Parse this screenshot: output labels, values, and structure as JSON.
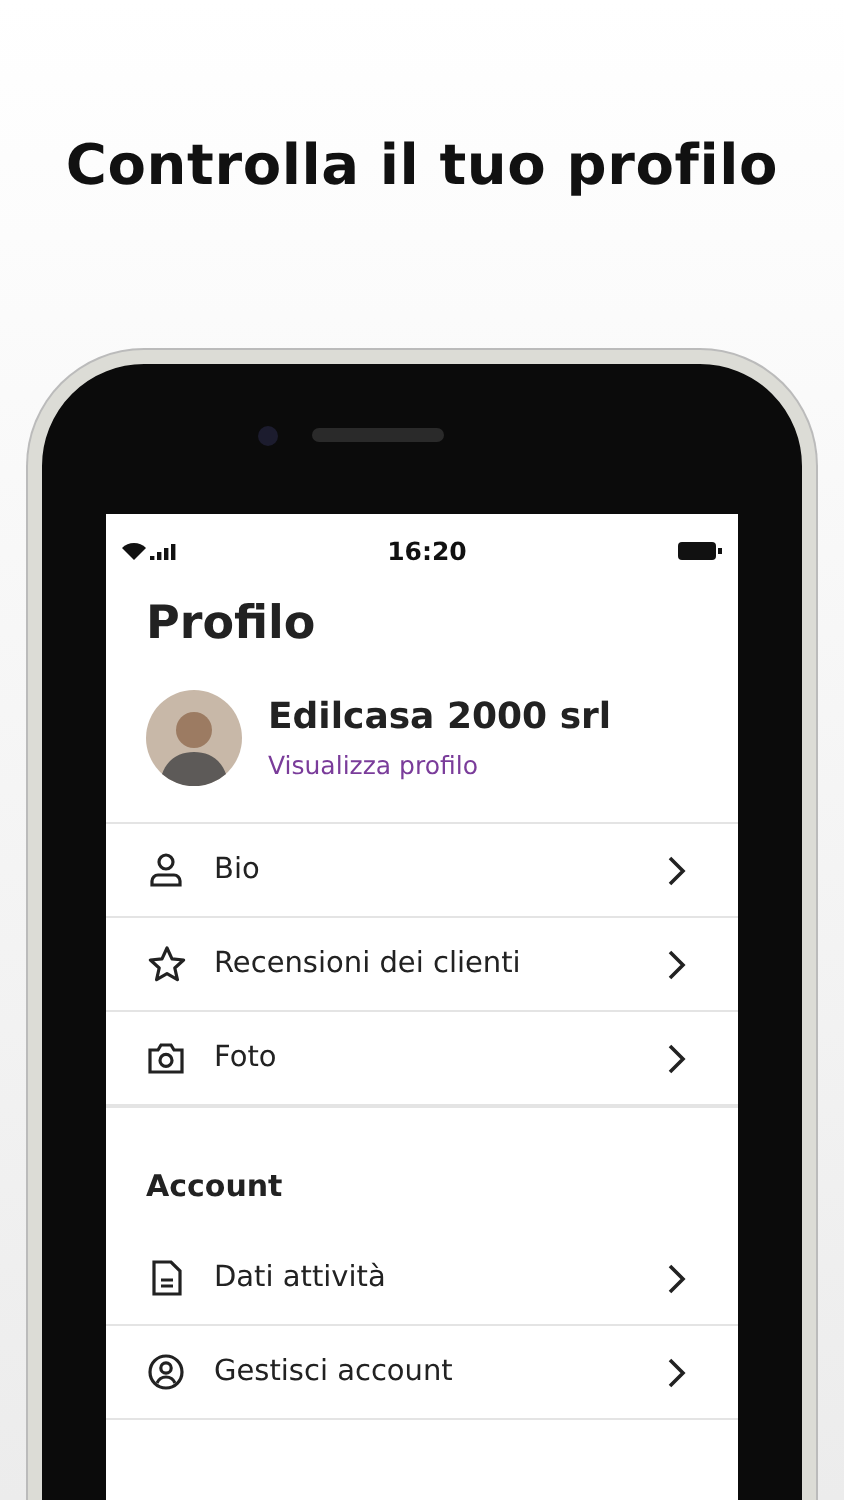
{
  "headline": "Controlla il tuo profilo",
  "status_bar": {
    "time": "16:20"
  },
  "screen_title": "Profilo",
  "profile": {
    "name": "Edilcasa 2000 srl",
    "link": "Visualizza profilo"
  },
  "menu": [
    {
      "kind": "person",
      "label": "Bio"
    },
    {
      "kind": "star",
      "label": "Recensioni dei clienti"
    },
    {
      "kind": "camera",
      "label": "Foto"
    }
  ],
  "account": {
    "title": "Account",
    "items": [
      {
        "kind": "document",
        "label": "Dati attività"
      },
      {
        "kind": "account",
        "label": "Gestisci account"
      }
    ]
  }
}
